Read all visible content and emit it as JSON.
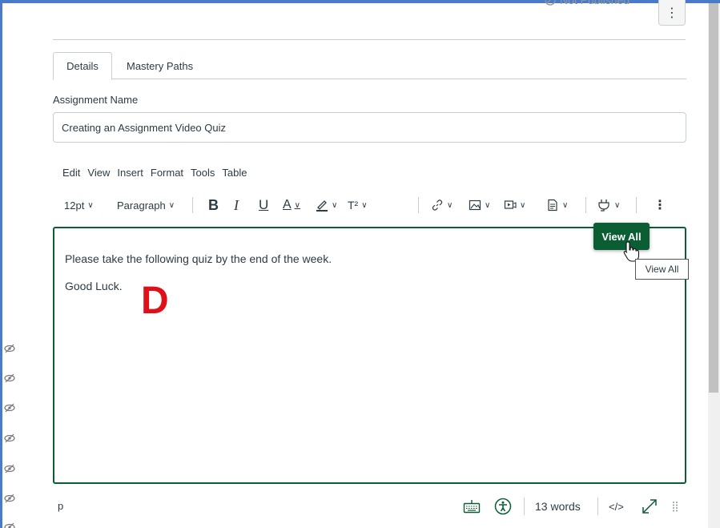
{
  "header": {
    "status_text": "Not Published",
    "more_button": "⋮"
  },
  "tabs": [
    {
      "label": "Details",
      "active": true
    },
    {
      "label": "Mastery Paths",
      "active": false
    }
  ],
  "assignment": {
    "label": "Assignment Name",
    "value": "Creating an Assignment Video Quiz"
  },
  "editor": {
    "menubar": [
      "Edit",
      "View",
      "Insert",
      "Format",
      "Tools",
      "Table"
    ],
    "toolbar": {
      "font_size": "12pt",
      "block_format": "Paragraph",
      "bold": "B",
      "italic": "I",
      "underline": "U",
      "text_color": "A",
      "superscript": "T²",
      "more": "⋮"
    },
    "content": [
      "Please take the following quiz by the end of the week.",
      "Good Luck."
    ],
    "annotation_letter": "D",
    "view_all_button": "View All",
    "tooltip": "View All"
  },
  "statusbar": {
    "path": "p",
    "word_count": "13 words",
    "html_toggle": "</>"
  },
  "colors": {
    "accent_green": "#0b5d34",
    "annotation_red": "#e0101a",
    "frame_blue": "#4a7bc8",
    "border": "#c7cdd1"
  },
  "icons": [
    "eye-slash-icon",
    "link-icon",
    "image-icon",
    "media-icon",
    "document-icon",
    "plug-icon",
    "keyboard-icon",
    "accessibility-icon",
    "fullscreen-icon",
    "resize-grip-icon",
    "hand-cursor-icon"
  ]
}
